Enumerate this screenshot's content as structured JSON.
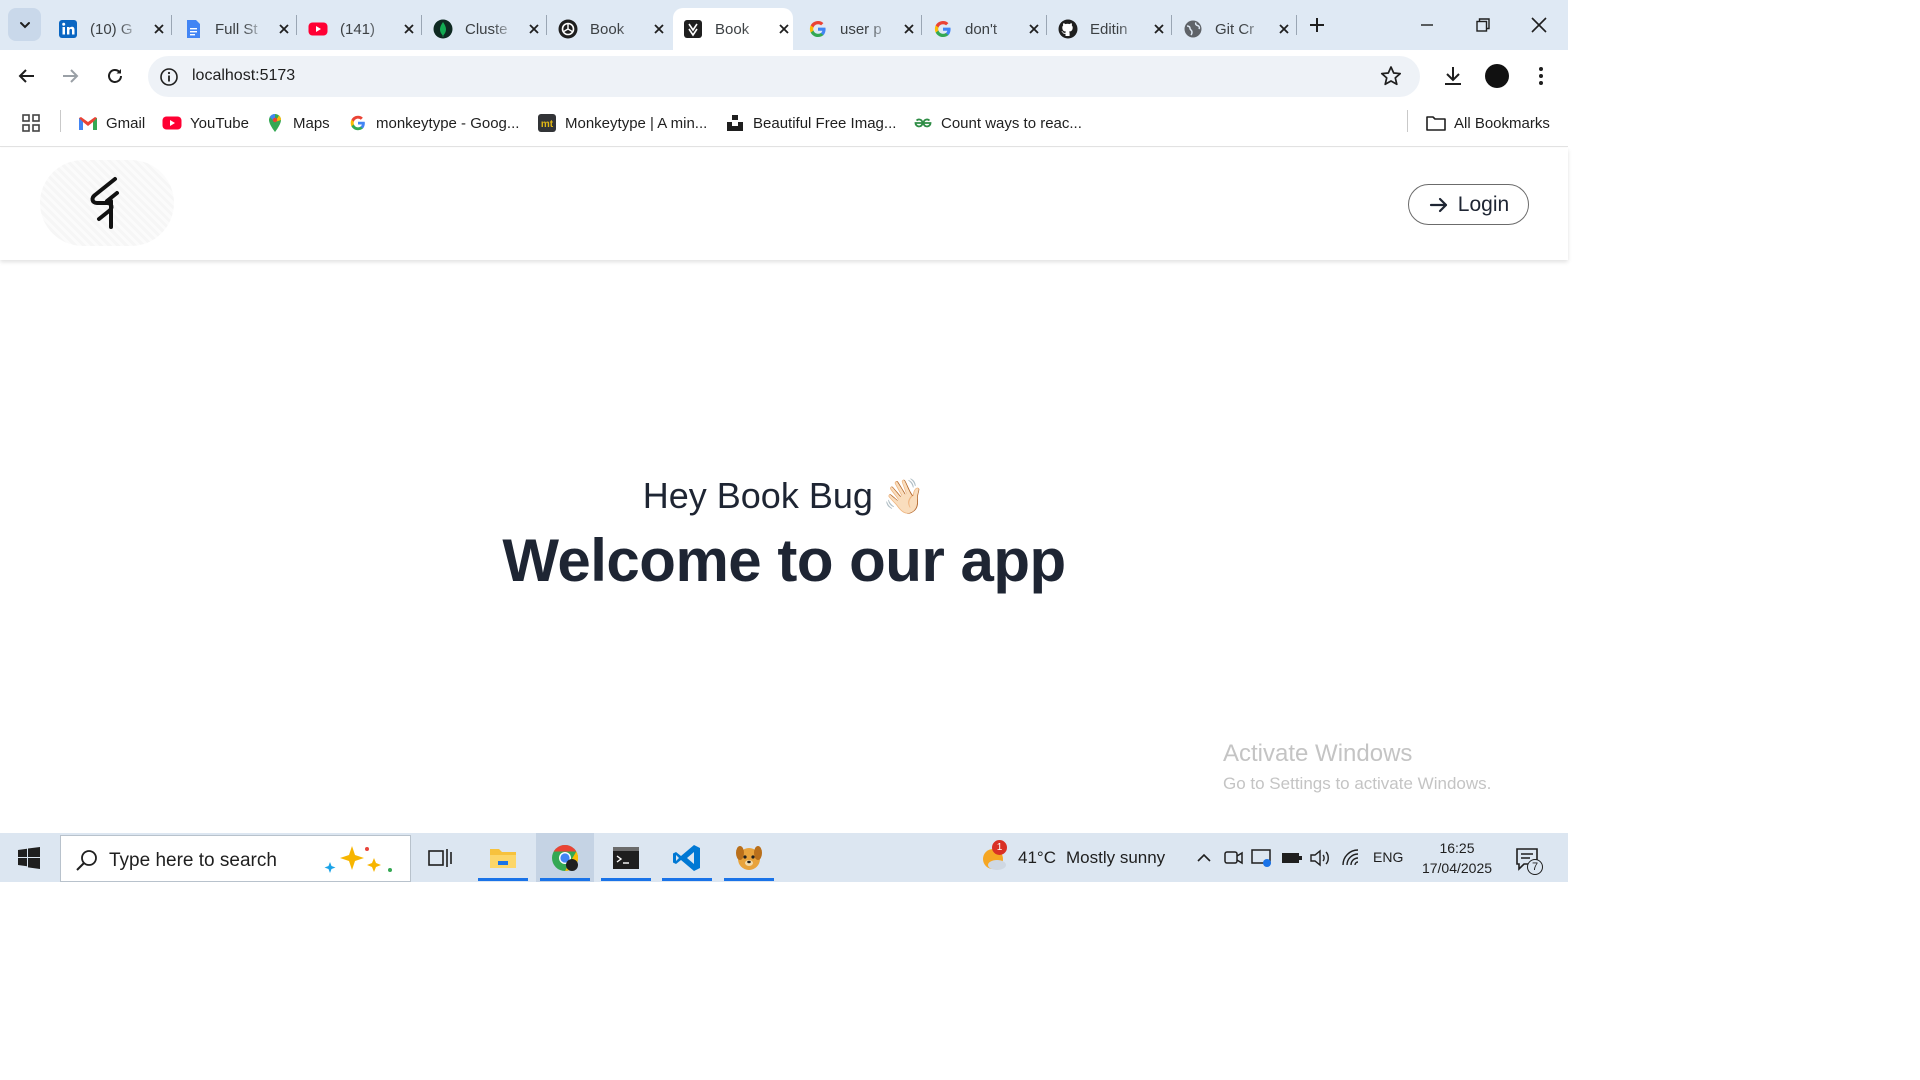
{
  "browser": {
    "tabs": [
      {
        "title": "(10) G",
        "icon": "linkedin-icon",
        "active": false
      },
      {
        "title": "Full St",
        "icon": "google-docs-icon",
        "active": false
      },
      {
        "title": "(141)",
        "icon": "youtube-icon",
        "active": false
      },
      {
        "title": "Cluste",
        "icon": "mongodb-icon",
        "active": false
      },
      {
        "title": "Book",
        "icon": "openai-icon",
        "active": false
      },
      {
        "title": "Book",
        "icon": "book-app-icon",
        "active": true
      },
      {
        "title": "user p",
        "icon": "google-icon",
        "active": false
      },
      {
        "title": "don't",
        "icon": "google-icon",
        "active": false
      },
      {
        "title": "Editin",
        "icon": "github-icon",
        "active": false
      },
      {
        "title": "Git Cr",
        "icon": "globe-icon",
        "active": false
      }
    ],
    "url": "localhost:5173",
    "bookmarks": [
      {
        "label": "Gmail",
        "icon": "gmail-icon"
      },
      {
        "label": "YouTube",
        "icon": "youtube-icon"
      },
      {
        "label": "Maps",
        "icon": "maps-icon"
      },
      {
        "label": "monkeytype - Goog...",
        "icon": "google-icon"
      },
      {
        "label": "Monkeytype | A min...",
        "icon": "monkeytype-icon"
      },
      {
        "label": "Beautiful Free Imag...",
        "icon": "unsplash-icon"
      },
      {
        "label": "Count ways to reac...",
        "icon": "geeksforgeeks-icon"
      }
    ],
    "all_bookmarks_label": "All Bookmarks"
  },
  "page": {
    "login_label": "Login",
    "greeting": "Hey Book Bug",
    "wave_emoji": "👋🏻",
    "welcome": "Welcome to our app"
  },
  "watermark": {
    "line1": "Activate Windows",
    "line2": "Go to Settings to activate Windows."
  },
  "taskbar": {
    "search_placeholder": "Type here to search",
    "weather_temp": "41°C",
    "weather_desc": "Mostly sunny",
    "weather_badge": "1",
    "language": "ENG",
    "time": "16:25",
    "date": "17/04/2025",
    "notification_count": "7"
  },
  "colors": {
    "tabstrip_bg": "#dfe9f4",
    "text_dark": "#1e2533",
    "taskbar_bg": "#dce6f1",
    "accent": "#1a73e8"
  }
}
